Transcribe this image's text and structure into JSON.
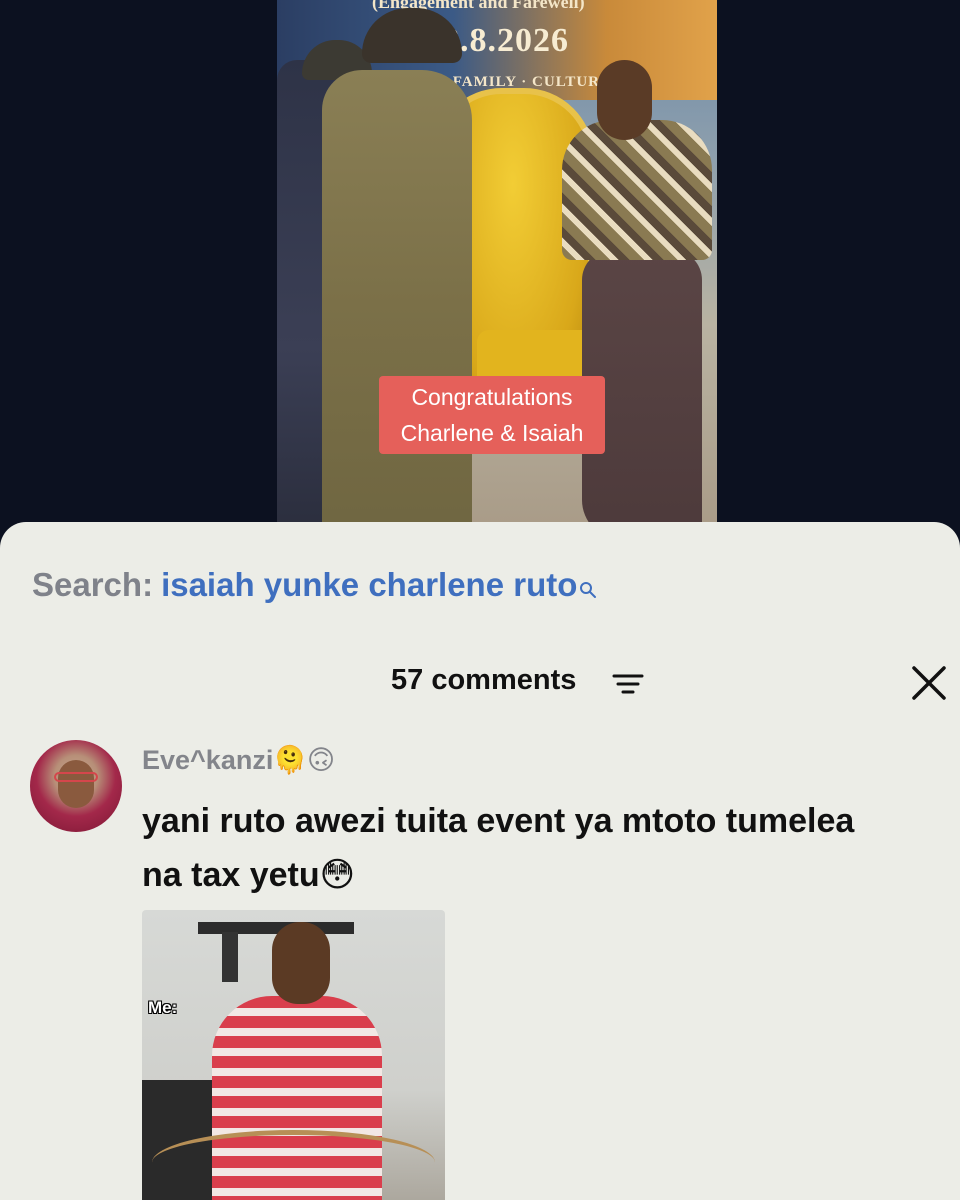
{
  "video": {
    "banner_top": "(Engagement and Farewell)",
    "banner_date": "8.8.2026",
    "banner_sub": "· FAMILY · CULTURE",
    "caption_line1": "Congratulations",
    "caption_line2": "Charlene & Isaiah"
  },
  "search": {
    "label": "Search:",
    "query": "isaiah yunke charlene ruto",
    "icon": "search-icon"
  },
  "comments_header": {
    "count_text": "57 comments",
    "sort_icon": "sort-icon",
    "close_icon": "close-icon"
  },
  "comment": {
    "username": "Eve^kanzi🫠🙃",
    "text": "yani ruto awezi tuita event ya mtoto tumelea na tax yetu😳",
    "meme_label": "Me:"
  },
  "colors": {
    "sheet_bg": "#ecede7",
    "search_query": "#3f6fbf",
    "caption_bg": "#e5605a"
  }
}
